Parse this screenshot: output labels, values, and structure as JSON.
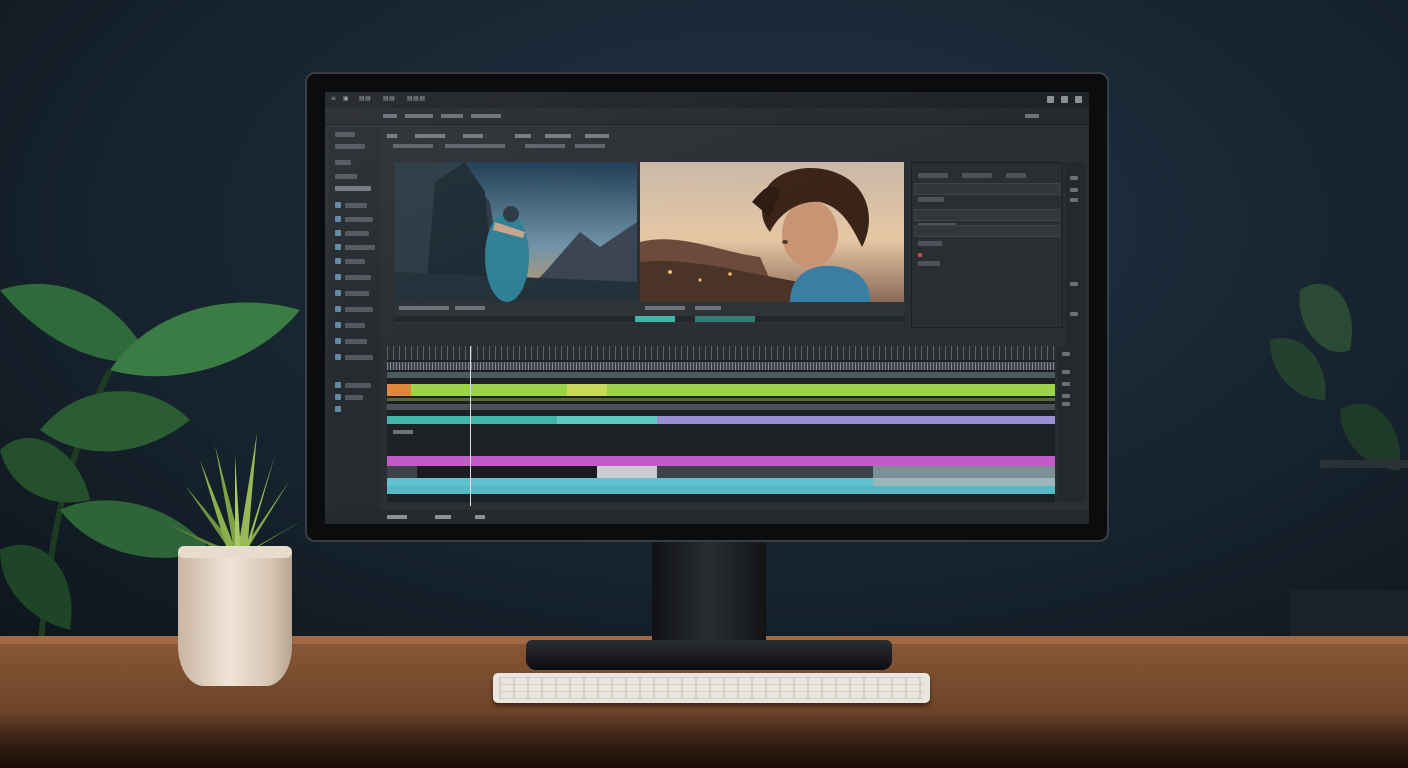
{
  "scene": {
    "description_colors": {
      "wall": "#17242f",
      "desk": "#7a4d2f",
      "pot": "#efe4d8",
      "succulent": "#8fae4a",
      "monitor_bezel": "#0b0c0e"
    }
  },
  "editor": {
    "menu_labels": [
      "≡",
      "▣",
      "▤▤",
      "▤▤",
      "▤▤▤"
    ],
    "window_controls": [
      "minimize",
      "maximize",
      "close"
    ],
    "timeline_tracks": [
      {
        "name": "audio-waveform",
        "color": "#5d6a72"
      },
      {
        "name": "audio-green",
        "color": "#9bd34a"
      },
      {
        "name": "video-teal",
        "color": "#3fb6a8"
      },
      {
        "name": "video-lavender",
        "color": "#9b8fd4"
      },
      {
        "name": "video-magenta",
        "color": "#c35bc7"
      },
      {
        "name": "video-cyan",
        "color": "#5fc3cf"
      }
    ],
    "accent_colors": {
      "teal": "#3fb6a8",
      "green": "#9bd34a",
      "magenta": "#c35bc7",
      "lavender": "#9b8fd4",
      "orange": "#e0873a"
    }
  }
}
